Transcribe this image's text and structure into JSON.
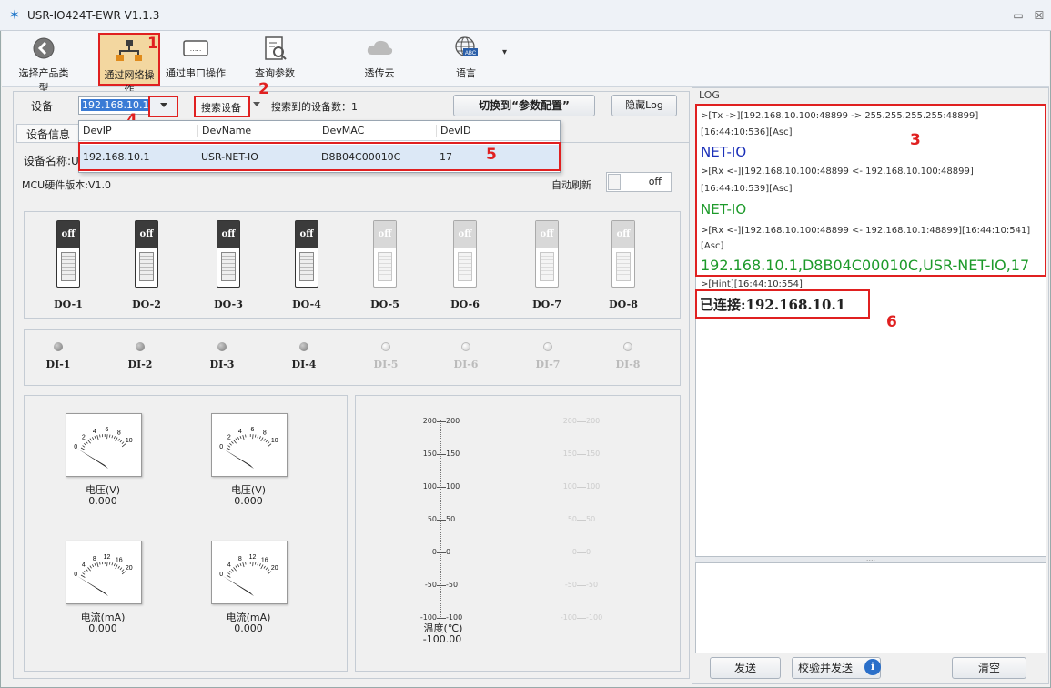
{
  "window": {
    "title": "USR-IO424T-EWR V1.1.3",
    "minimize": "▭",
    "close": "☒"
  },
  "toolbar": {
    "items": [
      {
        "label": "选择产品类型"
      },
      {
        "label": "通过网络操作"
      },
      {
        "label": "通过串口操作"
      },
      {
        "label": "查询参数"
      },
      {
        "label": "透传云"
      },
      {
        "label": "语言"
      }
    ],
    "more": "▾"
  },
  "device_bar": {
    "label": "设备",
    "ip_value": "192.168.10.1",
    "search_button": "搜索设备",
    "found_text": "搜索到的设备数：1",
    "switch_button": "切换到“参数配置”",
    "hide_log_button": "隐藏Log"
  },
  "tabs": {
    "device_info": "设备信息"
  },
  "dropdown": {
    "headers": [
      "DevIP",
      "DevName",
      "DevMAC",
      "DevID"
    ],
    "row": [
      "192.168.10.1",
      "USR-NET-IO",
      "D8B04C00010C",
      "17"
    ]
  },
  "info": {
    "device_name_label": "设备名称:U",
    "mcu_version": "MCU硬件版本:V1.0",
    "auto_refresh_label": "自动刷新",
    "auto_refresh_state": "off"
  },
  "do_switches": [
    {
      "label": "DO-1",
      "state": "off",
      "enabled": true
    },
    {
      "label": "DO-2",
      "state": "off",
      "enabled": true
    },
    {
      "label": "DO-3",
      "state": "off",
      "enabled": true
    },
    {
      "label": "DO-4",
      "state": "off",
      "enabled": true
    },
    {
      "label": "DO-5",
      "state": "off",
      "enabled": false
    },
    {
      "label": "DO-6",
      "state": "off",
      "enabled": false
    },
    {
      "label": "DO-7",
      "state": "off",
      "enabled": false
    },
    {
      "label": "DO-8",
      "state": "off",
      "enabled": false
    }
  ],
  "di_inputs": [
    {
      "label": "DI-1",
      "enabled": true
    },
    {
      "label": "DI-2",
      "enabled": true
    },
    {
      "label": "DI-3",
      "enabled": true
    },
    {
      "label": "DI-4",
      "enabled": true
    },
    {
      "label": "DI-5",
      "enabled": false
    },
    {
      "label": "DI-6",
      "enabled": false
    },
    {
      "label": "DI-7",
      "enabled": false
    },
    {
      "label": "DI-8",
      "enabled": false
    }
  ],
  "meters": [
    {
      "caption": "电压(V)",
      "value": "0.000",
      "scale": [
        "0",
        "2",
        "4",
        "6",
        "8",
        "10"
      ]
    },
    {
      "caption": "电压(V)",
      "value": "0.000",
      "scale": [
        "0",
        "2",
        "4",
        "6",
        "8",
        "10"
      ]
    },
    {
      "caption": "电流(mA)",
      "value": "0.000",
      "scale": [
        "0",
        "4",
        "8",
        "12",
        "16",
        "20"
      ]
    },
    {
      "caption": "电流(mA)",
      "value": "0.000",
      "scale": [
        "0",
        "4",
        "8",
        "12",
        "16",
        "20"
      ]
    }
  ],
  "thermometers": {
    "ticks": [
      "200",
      "150",
      "100",
      "50",
      "0",
      "-50",
      "-100"
    ],
    "caption": "温度(℃)",
    "value": "-100.00"
  },
  "log": {
    "title": "LOG",
    "lines": [
      ">[Tx ->][192.168.10.100:48899 -> 255.255.255.255:48899]",
      "[16:44:10:536][Asc]",
      "NET-IO",
      ">[Rx <-][192.168.10.100:48899 <- 192.168.10.100:48899]",
      "[16:44:10:539][Asc]",
      "NET-IO",
      ">[Rx <-][192.168.10.100:48899 <- 192.168.10.1:48899][16:44:10:541]",
      "[Asc]",
      "192.168.10.1,D8B04C00010C,USR-NET-IO,17",
      ">[Hint][16:44:10:554]",
      "已连接:192.168.10.1"
    ],
    "splitter": "....",
    "send_button": "发送",
    "checksum_send_button": "校验并发送",
    "info_icon": "i",
    "clear_button": "清空"
  },
  "annotations": [
    "1",
    "2",
    "3",
    "4",
    "5",
    "6"
  ],
  "colors": {
    "highlight": "#e02020",
    "log_blue": "#1a2fb8",
    "log_green": "#1d9a2a",
    "toolbar_active": "#f3d7a0"
  }
}
